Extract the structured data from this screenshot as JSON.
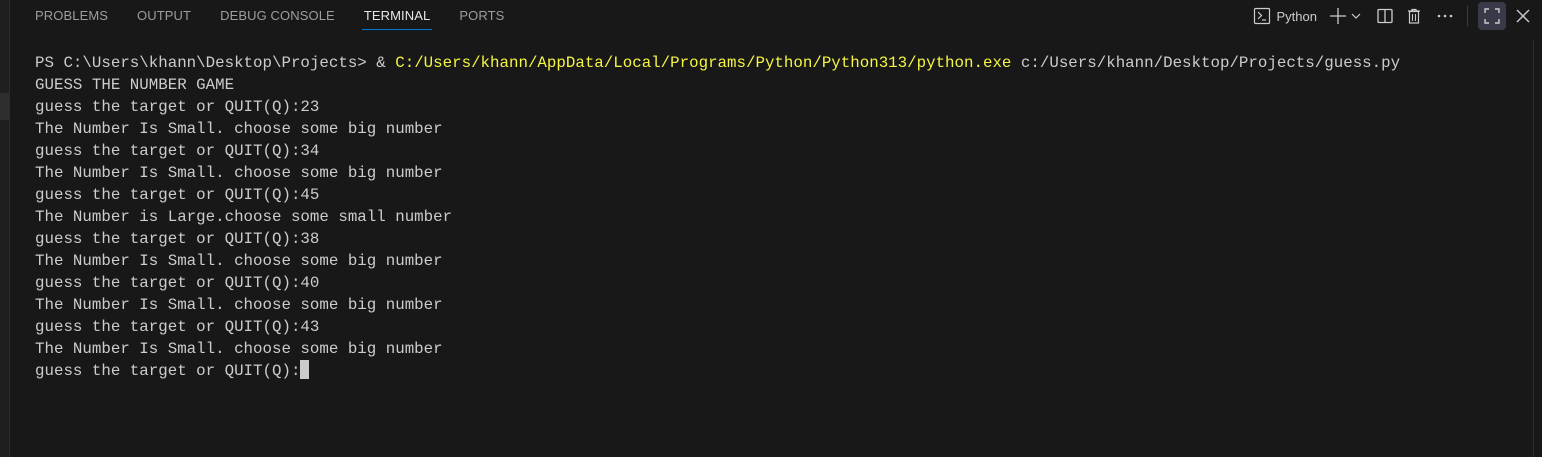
{
  "panel": {
    "tabs": [
      {
        "label": "PROBLEMS",
        "active": false
      },
      {
        "label": "OUTPUT",
        "active": false
      },
      {
        "label": "DEBUG CONSOLE",
        "active": false
      },
      {
        "label": "TERMINAL",
        "active": true
      },
      {
        "label": "PORTS",
        "active": false
      }
    ],
    "terminal_profile": "Python"
  },
  "terminal": {
    "prompt": "PS C:\\Users\\khann\\Desktop\\Projects> & ",
    "command_exe": "C:/Users/khann/AppData/Local/Programs/Python/Python313/python.exe",
    "command_arg": " c:/Users/khann/Desktop/Projects/guess.py",
    "lines": [
      "GUESS THE NUMBER GAME",
      "guess the target or QUIT(Q):23",
      "The Number Is Small. choose some big number",
      "guess the target or QUIT(Q):34",
      "The Number Is Small. choose some big number",
      "guess the target or QUIT(Q):45",
      "The Number is Large.choose some small number",
      "guess the target or QUIT(Q):38",
      "The Number Is Small. choose some big number",
      "guess the target or QUIT(Q):40",
      "The Number Is Small. choose some big number",
      "guess the target or QUIT(Q):43",
      "The Number Is Small. choose some big number"
    ],
    "current_input": "guess the target or QUIT(Q):"
  }
}
